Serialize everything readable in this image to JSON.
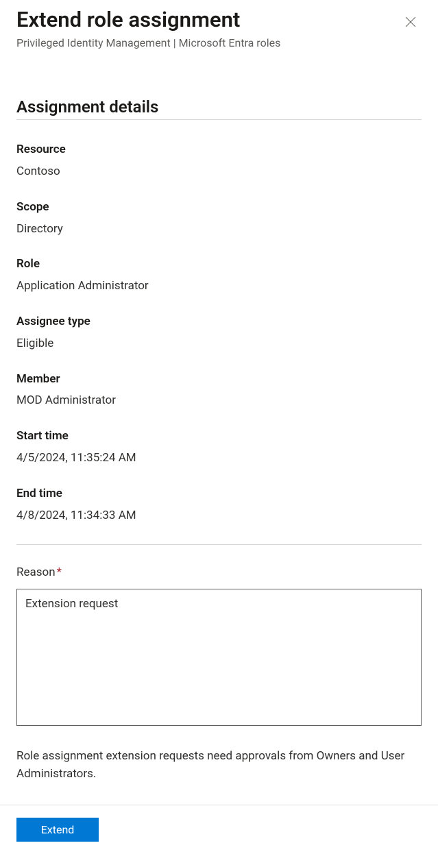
{
  "header": {
    "title": "Extend role assignment",
    "subtitle": "Privileged Identity Management | Microsoft Entra roles"
  },
  "section": {
    "title": "Assignment details"
  },
  "details": {
    "resource": {
      "label": "Resource",
      "value": "Contoso"
    },
    "scope": {
      "label": "Scope",
      "value": "Directory"
    },
    "role": {
      "label": "Role",
      "value": "Application Administrator"
    },
    "assigneeType": {
      "label": "Assignee type",
      "value": "Eligible"
    },
    "member": {
      "label": "Member",
      "value": "MOD Administrator"
    },
    "startTime": {
      "label": "Start time",
      "value": "4/5/2024, 11:35:24 AM"
    },
    "endTime": {
      "label": "End time",
      "value": "4/8/2024, 11:34:33 AM"
    }
  },
  "reason": {
    "label": "Reason",
    "value": "Extension request"
  },
  "info": "Role assignment extension requests need approvals from Owners and User Administrators.",
  "footer": {
    "extend": "Extend"
  }
}
